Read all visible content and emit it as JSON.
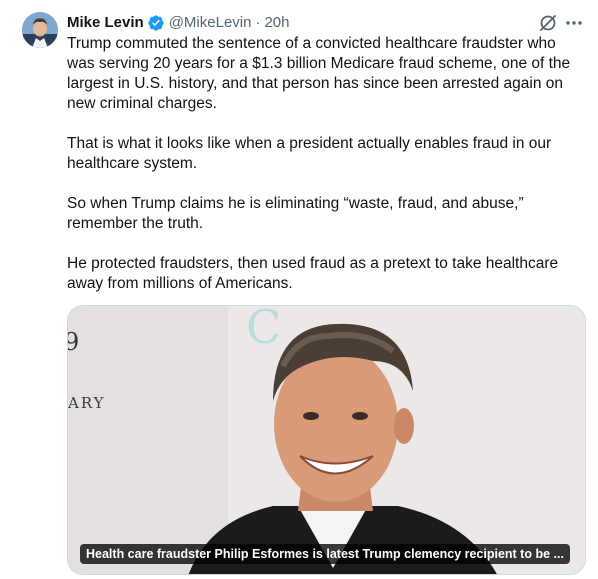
{
  "author": {
    "display_name": "Mike Levin",
    "handle": "@MikeLevin",
    "separator": "·",
    "time": "20h",
    "verified": true,
    "avatar_icon": "avatar-photo"
  },
  "tweet": {
    "paragraphs": [
      "Trump commuted the sentence of a convicted healthcare fraudster who was serving 20 years for a $1.3 billion Medicare fraud scheme, one of the largest in U.S. history, and that person has since been arrested again on new criminal charges.",
      "That is what it looks like when a president actually enables fraud in our healthcare system.",
      "So when Trump claims he is eliminating “waste, fraud, and abuse,” remember the truth.",
      "He protected fraudsters, then used fraud as a pretext to take healthcare away from millions of Americans."
    ]
  },
  "media": {
    "caption": "Health care fraudster Philip Esformes is latest Trump clemency recipient to be ...",
    "backdrop_text_ary": "ARY",
    "backdrop_text_mark": "9",
    "backdrop_text_logo": "C",
    "photo_icon": "news-photo"
  },
  "icons": {
    "verified": "verified-badge-icon",
    "grok": "grok-icon",
    "more": "more-icon"
  },
  "colors": {
    "text": "#0f1419",
    "secondary": "#536471",
    "verified_blue": "#1d9bf0",
    "border": "#cfd9de"
  }
}
